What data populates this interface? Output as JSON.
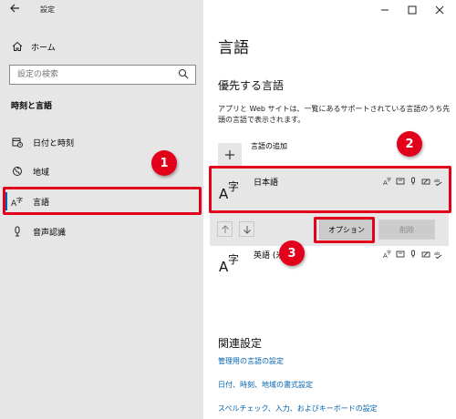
{
  "window": {
    "title": "設定",
    "back_icon": "arrow-left-icon",
    "controls": [
      "minimize-icon",
      "maximize-icon",
      "close-icon"
    ]
  },
  "sidebar": {
    "home_label": "ホーム",
    "search_placeholder": "設定の検索",
    "section_label": "時刻と言語",
    "items": [
      {
        "label": "日付と時刻",
        "icon": "calendar-clock-icon"
      },
      {
        "label": "地域",
        "icon": "globe-region-icon"
      },
      {
        "label": "言語",
        "icon": "language-icon",
        "active": true
      },
      {
        "label": "音声認識",
        "icon": "microphone-icon"
      }
    ]
  },
  "main": {
    "page_title": "言語",
    "preferred_title": "優先する言語",
    "preferred_desc": "アプリと Web サイトは、一覧にあるサポートされている言語のうち先頭の言語で表示されます。",
    "add_language_label": "言語の追加",
    "languages": [
      {
        "name": "日本語",
        "selected": true
      },
      {
        "name": "英語 (米"
      }
    ],
    "options_button": "オプション",
    "remove_button": "削除",
    "related_title": "関連設定",
    "links": [
      "管理用の言語の設定",
      "日付、時刻、地域の書式設定",
      "スペルチェック、入力、およびキーボードの設定"
    ]
  },
  "annotations": {
    "badge1": "1",
    "badge2": "2",
    "badge3": "3"
  },
  "colors": {
    "accent": "#0063b1",
    "highlight": "#e2001a",
    "sidebar_bg": "#e6e6e6"
  }
}
